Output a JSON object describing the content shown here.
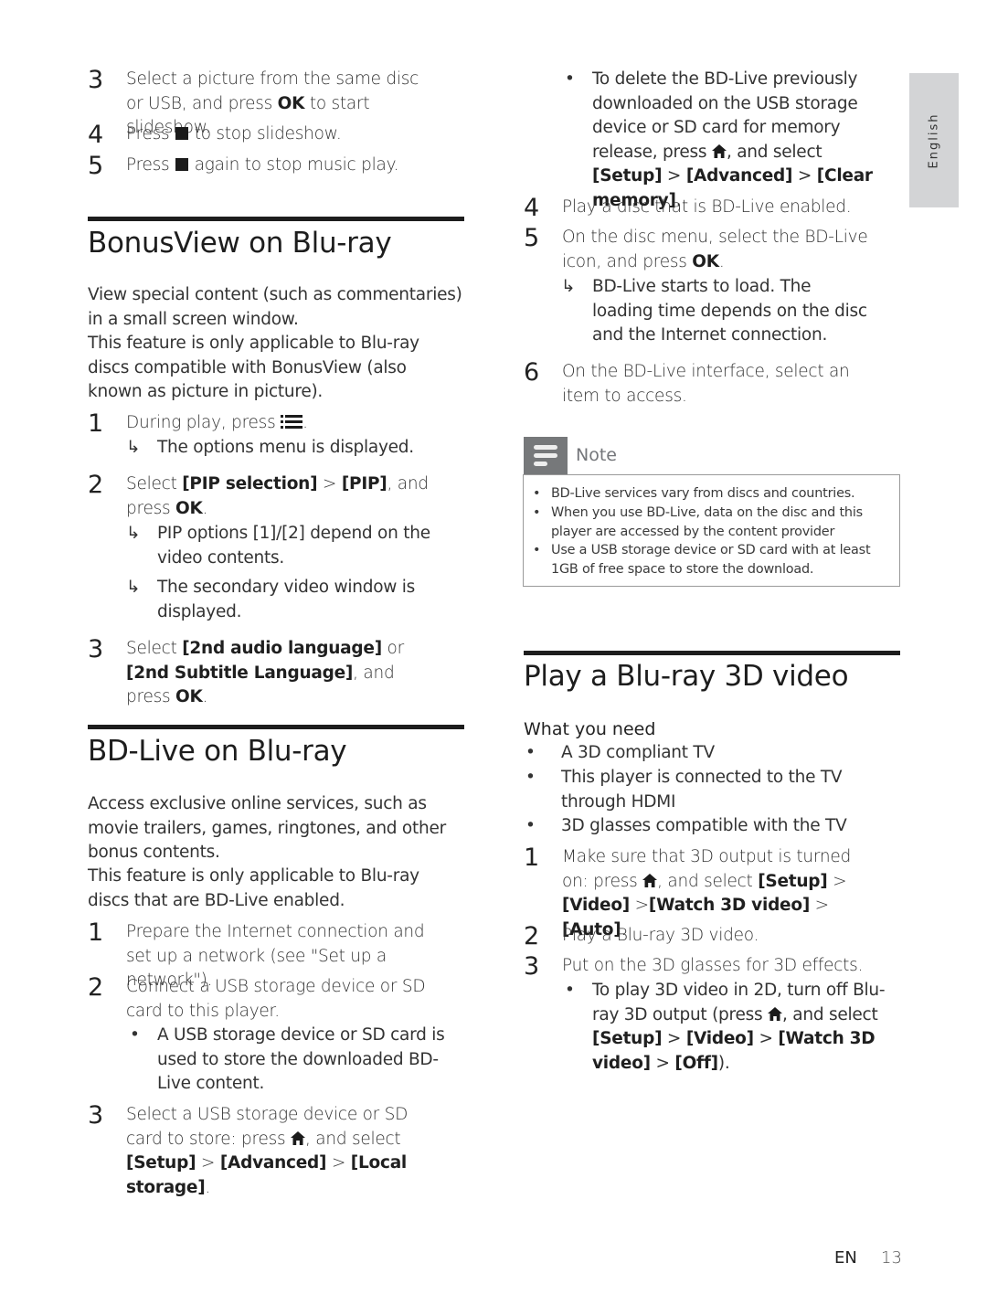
{
  "page": {
    "language_tab": "English",
    "footer_lang": "EN",
    "page_number": "13"
  },
  "left": {
    "top_steps": [
      {
        "num": "3",
        "text_a": "Select a picture from the same disc or USB, and press ",
        "bold_a": "OK",
        "text_b": " to start slideshow."
      },
      {
        "num": "4",
        "text_a": "Press ",
        "icon": "stop-icon",
        "text_b": " to stop slideshow."
      },
      {
        "num": "5",
        "text_a": "Press ",
        "icon": "stop-icon",
        "text_b": " again to stop music play."
      }
    ],
    "bonusview": {
      "title": "BonusView on Blu-ray",
      "para1": "View special content (such as commentaries) in a small screen window.",
      "para2": "This feature is only applicable to Blu-ray discs compatible with BonusView (also known as picture in picture).",
      "steps": [
        {
          "num": "1",
          "text_a": "During play, press ",
          "icon": "options-menu-icon",
          "text_b": ".",
          "results": [
            "The options menu is displayed."
          ]
        },
        {
          "num": "2",
          "text_a": "Select ",
          "bold_a": "[PIP selection]",
          "text_b": " > ",
          "bold_b": "[PIP]",
          "text_c": ", and press ",
          "bold_c": "OK",
          "text_d": ".",
          "results": [
            "PIP options [1]/[2] depend on the video contents.",
            "The secondary video window is displayed."
          ]
        },
        {
          "num": "3",
          "text_a": "Select ",
          "bold_a": "[2nd audio language]",
          "text_b": " or ",
          "bold_b": "[2nd Subtitle Language]",
          "text_c": ", and press ",
          "bold_c": "OK",
          "text_d": "."
        }
      ]
    },
    "bdlive": {
      "title": "BD-Live on Blu-ray",
      "para1": "Access exclusive online services, such as movie trailers, games, ringtones, and other bonus contents.",
      "para2": "This feature is only applicable to Blu-ray discs that are BD-Live enabled.",
      "steps": [
        {
          "num": "1",
          "text": "Prepare the Internet connection and set up a network (see \"Set up a network\")."
        },
        {
          "num": "2",
          "text": "Connect a USB storage device or SD card to this player.",
          "bullets": [
            "A USB storage device or SD card is used to store the downloaded BD-Live content."
          ]
        },
        {
          "num": "3",
          "text_a": "Select a USB storage device or SD card to store: press ",
          "icon": "home-icon",
          "text_b": ", and select ",
          "bold_a": "[Setup]",
          "text_c": " > ",
          "bold_b": "[Advanced]",
          "text_d": " > ",
          "bold_c": "[Local storage]",
          "text_e": "."
        }
      ]
    }
  },
  "right": {
    "bdlive_cont": {
      "bullet": {
        "text_a": "To delete the BD-Live previously downloaded on the USB storage device or SD card for memory release, press ",
        "icon": "home-icon",
        "text_b": ", and select ",
        "bold_a": "[Setup]",
        "text_c": " > ",
        "bold_b": "[Advanced]",
        "text_d": " > ",
        "bold_c": "[Clear memory]",
        "text_e": "."
      },
      "steps": [
        {
          "num": "4",
          "text": "Play a disc that is BD-Live enabled."
        },
        {
          "num": "5",
          "text_a": "On the disc menu, select the BD-Live icon, and press ",
          "bold_a": "OK",
          "text_b": ".",
          "results": [
            "BD-Live starts to load. The loading time depends on the disc and the Internet connection."
          ]
        },
        {
          "num": "6",
          "text": "On the BD-Live interface, select an item to access."
        }
      ]
    },
    "note": {
      "label": "Note",
      "items": [
        "BD-Live services vary from discs and countries.",
        "When you use BD-Live, data on the disc and this player are accessed by the content provider",
        "Use a USB storage device or SD card with at least 1GB of free space to store the download."
      ]
    },
    "play3d": {
      "title": "Play a Blu-ray 3D video",
      "need_label": "What you need",
      "needs": [
        "A 3D compliant TV",
        "This player is connected to the TV through HDMI",
        "3D glasses compatible with the TV"
      ],
      "steps": [
        {
          "num": "1",
          "text_a": "Make sure that 3D output is turned on: press ",
          "icon": "home-icon",
          "text_b": ", and select ",
          "bold_a": "[Setup]",
          "text_c": " > ",
          "bold_b": "[Video]",
          "text_d": " >",
          "bold_c": "[Watch 3D video]",
          "text_e": " > ",
          "bold_d": "[Auto]",
          "text_f": "."
        },
        {
          "num": "2",
          "text": "Play a Blu-ray 3D video."
        },
        {
          "num": "3",
          "text": "Put on the 3D glasses for 3D effects.",
          "bullets": [
            {
              "text_a": "To play 3D video in 2D, turn off Blu-ray 3D output (press ",
              "icon": "home-icon",
              "text_b": ", and select ",
              "bold_a": "[Setup]",
              "text_c": " > ",
              "bold_b": "[Video]",
              "text_d": " > ",
              "bold_c": "[Watch 3D video]",
              "text_e": " > ",
              "bold_d": "[Off]",
              "text_f": ")."
            }
          ]
        }
      ]
    }
  },
  "marks": {
    "result_arrow": "↳",
    "bullet": "•"
  }
}
